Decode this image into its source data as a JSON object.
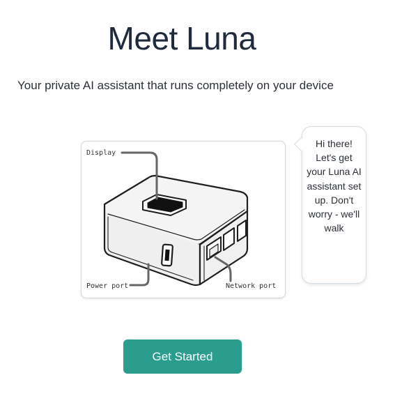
{
  "header": {
    "title": "Meet Luna",
    "subtitle": "Your private AI assistant that runs completely on your device"
  },
  "device_diagram": {
    "labels": {
      "display": "Display",
      "power_port": "Power port",
      "network_port": "Network port"
    }
  },
  "speech_bubble": {
    "text": "Hi there! Let's get your Luna AI assistant set up. Don't worry - we'll walk"
  },
  "actions": {
    "get_started_label": "Get Started"
  },
  "colors": {
    "accent": "#2a9d8f",
    "title_text": "#1f2a3c",
    "body_text": "#2b2f36"
  }
}
